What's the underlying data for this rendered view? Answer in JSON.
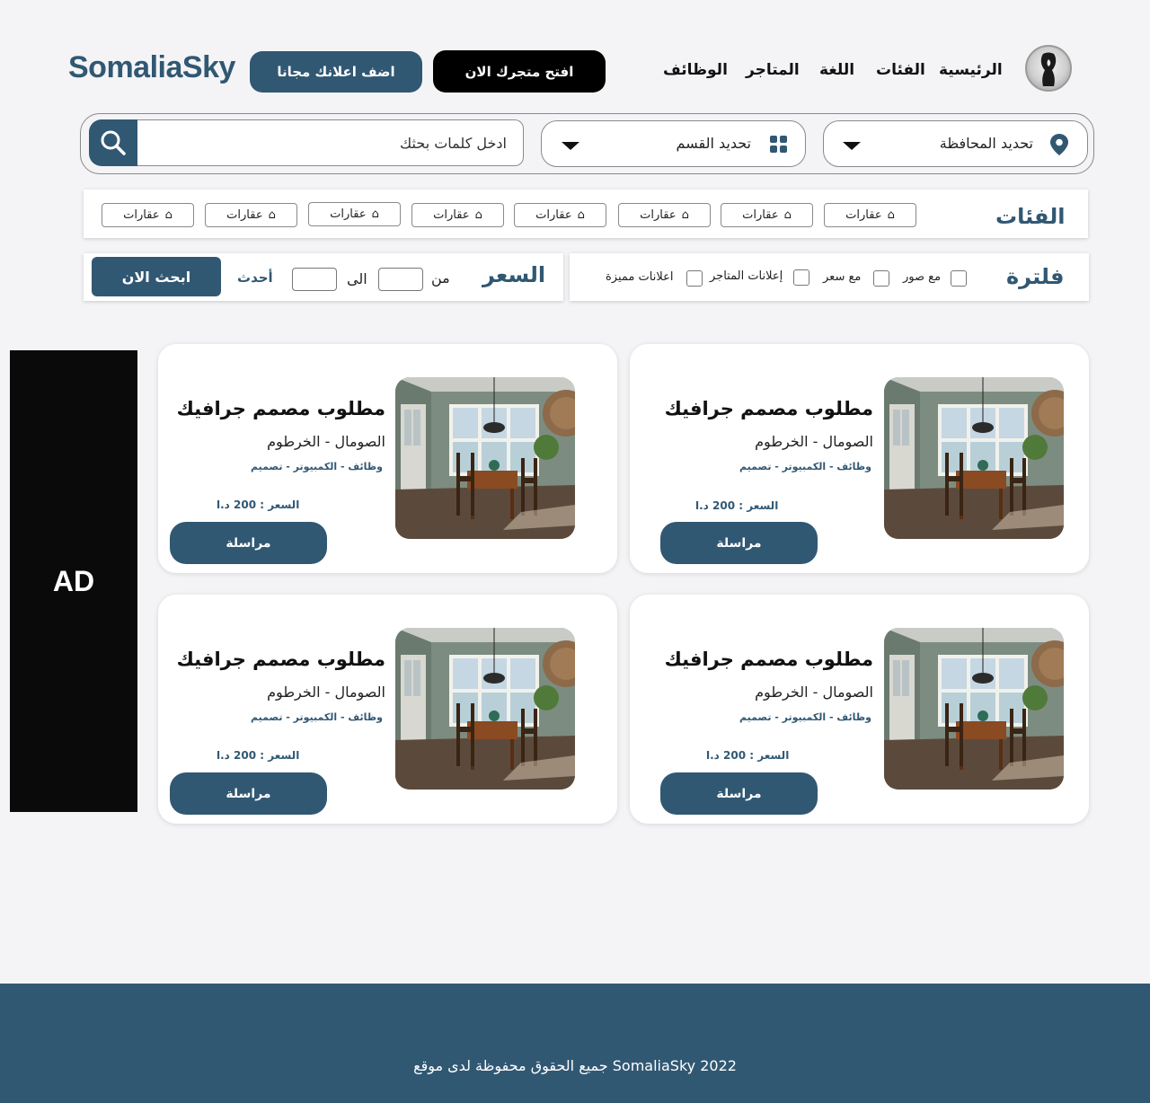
{
  "header": {
    "brand": "SomaliaSky",
    "add_ad_label": "اضف اعلانك مجانا",
    "open_store_label": "افتح متجرك الان",
    "nav": {
      "home": "الرئيسية",
      "categories": "الفئات",
      "language": "اللغة",
      "stores": "المتاجر",
      "jobs": "الوظائف"
    }
  },
  "search": {
    "placeholder": "ادخل كلمات بحثك",
    "section_select": "تحديد القسم",
    "governorate_select": "تحديد المحافظة"
  },
  "categories": {
    "title": "الفئات",
    "chips": [
      "عقارات",
      "عقارات",
      "عقارات",
      "عقارات",
      "عقارات",
      "عقارات",
      "عقارات",
      "عقارات"
    ]
  },
  "filter": {
    "title": "فلترة",
    "options": [
      "مع صور",
      "مع سعر",
      "إعلانات المتاجر",
      "اعلانات مميزة"
    ]
  },
  "price": {
    "title": "السعر",
    "from": "من",
    "to": "الى",
    "newest": "أحدث",
    "search_now": "ابحث الان"
  },
  "ad": {
    "label": "AD"
  },
  "listings": [
    {
      "title": "مطلوب مصمم جرافيك",
      "location": "الصومال - الخرطوم",
      "tags": "وظائف - الكمبيوتر - تصميم",
      "price": "السعر : 200 د.ا",
      "message": "مراسلة"
    },
    {
      "title": "مطلوب مصمم جرافيك",
      "location": "الصومال - الخرطوم",
      "tags": "وظائف - الكمبيوتر - تصميم",
      "price": "السعر : 200 د.ا",
      "message": "مراسلة"
    },
    {
      "title": "مطلوب مصمم جرافيك",
      "location": "الصومال - الخرطوم",
      "tags": "وظائف - الكمبيوتر - تصميم",
      "price": "السعر : 200 د.ا",
      "message": "مراسلة"
    },
    {
      "title": "مطلوب مصمم جرافيك",
      "location": "الصومال - الخرطوم",
      "tags": "وظائف - الكمبيوتر - تصميم",
      "price": "السعر : 200 د.ا",
      "message": "مراسلة"
    }
  ],
  "footer": {
    "text": "SomaliaSky 2022 جميع الحقوق محفوظة لدى موقع"
  },
  "colors": {
    "accent": "#315873",
    "background": "#f4f4f7",
    "ad_block": "#0a0a0a"
  }
}
